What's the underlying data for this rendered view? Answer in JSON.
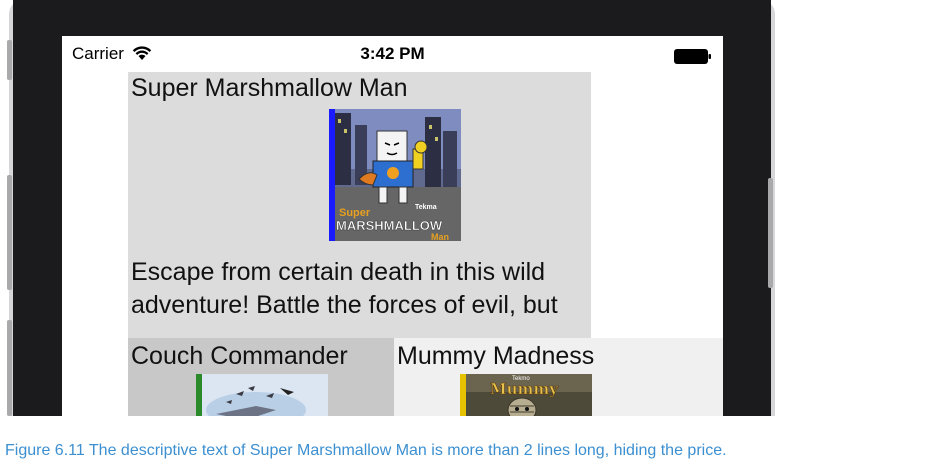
{
  "status_bar": {
    "carrier": "Carrier",
    "time": "3:42 PM",
    "wifi_icon": "wifi-icon",
    "battery_icon": "battery-full-icon"
  },
  "games": [
    {
      "title": "Super Marshmallow Man",
      "description": "Escape from certain death in this wild adventure! Battle the forces of evil, but",
      "cover_text": {
        "publisher": "Tekma",
        "line1": "Super",
        "line2": "MARSHMALLOW",
        "line3": "Man"
      },
      "stripe_color": "#1a1aff"
    },
    {
      "title": "Couch Commander",
      "stripe_color": "#2a8a2a"
    },
    {
      "title": "Mummy Madness",
      "cover_text": {
        "publisher": "Tekmo",
        "line1": "Mummy"
      },
      "stripe_color": "#e6c200"
    }
  ],
  "caption": "Figure 6.11 The descriptive text of Super Marshmallow Man is more than 2 lines long, hiding the price.",
  "colors": {
    "caption": "#3c8fd0",
    "card_bg": "#dcdcdc",
    "frame": "#1b1b1d"
  }
}
